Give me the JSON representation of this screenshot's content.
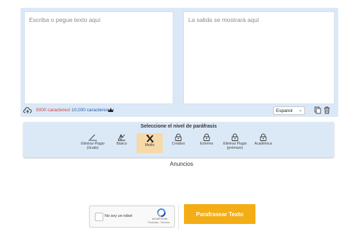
{
  "editor": {
    "input_placeholder": "Escriba o pegue texto aquí",
    "output_placeholder": "La salida se mostrará aquí",
    "count_free": "5000 caracteres!",
    "count_premium": "10,000 caracteres",
    "language": "Espanol"
  },
  "levels": {
    "title": "Seleccione el nivel de paráfrasis",
    "items": [
      {
        "label": "Eliminar Plagio\n(Gratis)",
        "icon": "pen-icon"
      },
      {
        "label": "Básico",
        "icon": "basic-icon"
      },
      {
        "label": "Medio",
        "icon": "medio-icon",
        "active": true
      },
      {
        "label": "Creativo",
        "icon": "lock-icon"
      },
      {
        "label": "Extremo",
        "icon": "lock-icon"
      },
      {
        "label": "Eliminar Plagio\n(prémium)",
        "icon": "lock-icon"
      },
      {
        "label": "Académica",
        "icon": "lock-icon"
      }
    ]
  },
  "ads": {
    "label": "Anuncios"
  },
  "captcha": {
    "label": "No soy un robot",
    "brand": "reCAPTCHA",
    "links": "Privacidad - Términos"
  },
  "submit": {
    "label": "Parafrasear Texto"
  },
  "colors": {
    "accent": "#f4ad14",
    "panel": "#dbe9f7",
    "active_level": "#f6d9a8"
  }
}
